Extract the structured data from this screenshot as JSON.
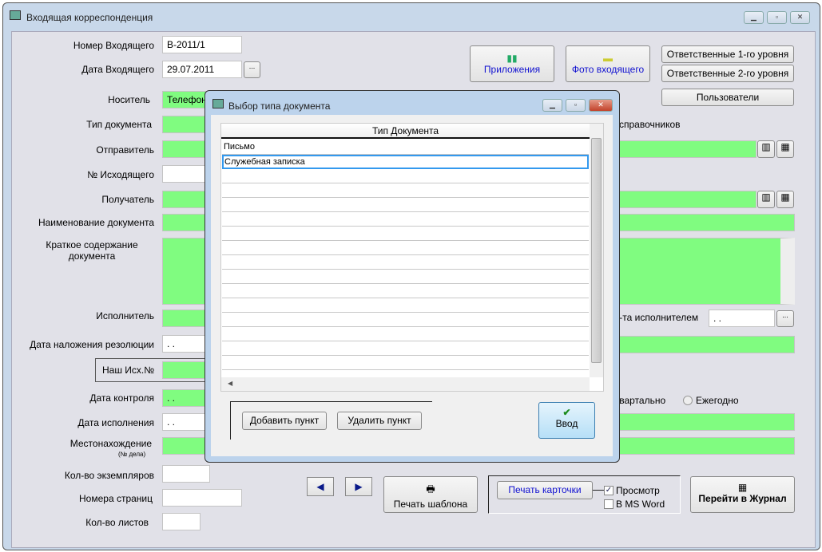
{
  "window": {
    "title": "Входящая корреспонденция"
  },
  "form": {
    "incoming_number": {
      "label": "Номер Входящего",
      "value": "В-2011/1"
    },
    "incoming_date": {
      "label": "Дата Входящего",
      "value": "29.07.2011",
      "button": "..."
    },
    "carrier": {
      "label": "Носитель",
      "value": "Телефон"
    },
    "doc_type": {
      "label": "Тип документа",
      "value": ""
    },
    "sender": {
      "label": "Отправитель",
      "value": ""
    },
    "outgoing_number": {
      "label": "№ Исходящего",
      "value": ""
    },
    "recipient": {
      "label": "Получатель",
      "value": ""
    },
    "doc_name": {
      "label": "Наименование документа",
      "value": ""
    },
    "summary": {
      "label": "Краткое содержание документа",
      "value": ""
    },
    "executor": {
      "label": "Исполнитель",
      "value": ""
    },
    "resolution_date": {
      "label": "Дата наложения резолюции",
      "value": " .  ."
    },
    "our_outgoing": {
      "label": "Наш Исх.№",
      "value": ""
    },
    "control_date": {
      "label": "Дата контроля",
      "value": " .  ."
    },
    "execution_date": {
      "label": "Дата исполнения",
      "value": " .  ."
    },
    "location": {
      "label": "Местонахождение",
      "sublabel": "(№ дела)",
      "value": ""
    },
    "copies": {
      "label": "Кол-во экземпляров",
      "value": ""
    },
    "pages": {
      "label": "Номера страниц",
      "value": ""
    },
    "sheets": {
      "label": "Кол-во листов",
      "value": ""
    },
    "directories_text": "справочников",
    "executor_date": {
      "label": "к-та исполнителем",
      "value": " .  .",
      "button": "..."
    },
    "period": {
      "quarterly": "квартально",
      "yearly": "Ежегодно"
    }
  },
  "toolbar": {
    "attachments": "Приложения",
    "photo": "Фото входящего",
    "resp1": "Ответственные 1-го уровня",
    "resp2": "Ответственные 2-го уровня",
    "users": "Пользователи"
  },
  "bottom": {
    "print_template": "Печать шаблона",
    "print_card": "Печать карточки",
    "preview": {
      "label": "Просмотр",
      "checked": true
    },
    "msword": {
      "label": "В MS Word",
      "checked": false
    },
    "journal": "Перейти в Журнал"
  },
  "dialog": {
    "title": "Выбор типа документа",
    "column": "Тип Документа",
    "rows": [
      "Письмо",
      "Служебная записка"
    ],
    "selected_index": 1,
    "add": "Добавить пункт",
    "delete": "Удалить пункт",
    "enter": "Ввод"
  },
  "colors": {
    "field_green": "#80fc80",
    "link_blue": "#1010d0"
  }
}
